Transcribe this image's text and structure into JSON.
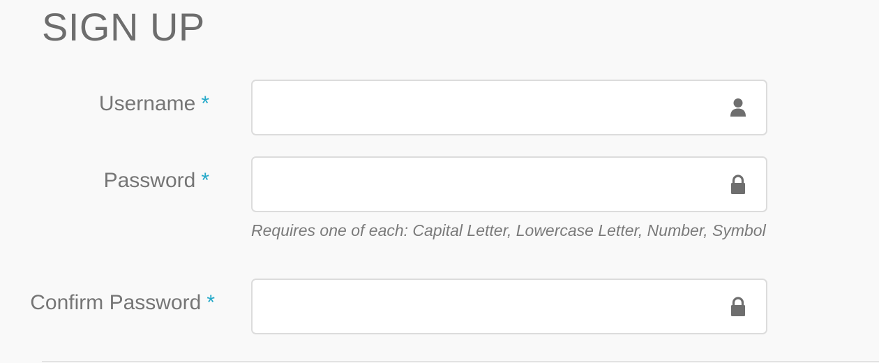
{
  "title": "SIGN UP",
  "fields": {
    "username": {
      "label": "Username",
      "required_mark": "*",
      "value": "",
      "icon": "user-icon"
    },
    "password": {
      "label": "Password",
      "required_mark": "*",
      "value": "",
      "icon": "lock-icon",
      "hint": "Requires one of each: Capital Letter, Lowercase Letter, Number, Symbol"
    },
    "confirm_password": {
      "label": "Confirm Password",
      "required_mark": "*",
      "value": "",
      "icon": "lock-icon"
    }
  },
  "colors": {
    "required_accent": "#25a9c9",
    "background": "#f9f9f9",
    "text": "#757575",
    "input_border": "#dcdcdc"
  }
}
